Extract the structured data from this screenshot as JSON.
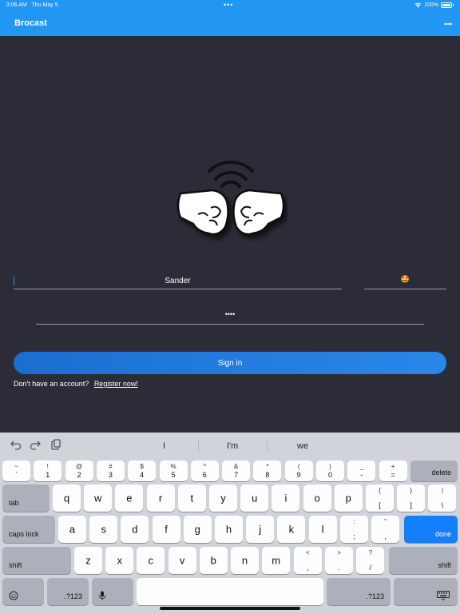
{
  "status": {
    "time": "3:06 AM",
    "date": "Thu May 5",
    "dots": "•••",
    "battery": "100%"
  },
  "app": {
    "title": "Brocast",
    "overflow": "⋮"
  },
  "form": {
    "name_value": "Sander",
    "emoji_value": "🤩",
    "password_value": "••••",
    "signin_label": "Sign in",
    "no_account": "Don't have an account?",
    "register_label": "Register now!"
  },
  "colors": {
    "appbar": "#2196f3",
    "background": "#2b2c37",
    "button": "#1f7de0",
    "keyboard": "#d1d3da",
    "done_key": "#147efb"
  },
  "keyboard": {
    "suggestions": [
      "I",
      "I'm",
      "we"
    ],
    "tool_icons": [
      "undo-icon",
      "redo-icon",
      "clipboard-icon"
    ],
    "row1": [
      {
        "t": "~",
        "b": "`"
      },
      {
        "t": "!",
        "b": "1"
      },
      {
        "t": "@",
        "b": "2"
      },
      {
        "t": "#",
        "b": "3"
      },
      {
        "t": "$",
        "b": "4"
      },
      {
        "t": "%",
        "b": "5"
      },
      {
        "t": "^",
        "b": "6"
      },
      {
        "t": "&",
        "b": "7"
      },
      {
        "t": "*",
        "b": "8"
      },
      {
        "t": "(",
        "b": "9"
      },
      {
        "t": ")",
        "b": "0"
      },
      {
        "t": "_",
        "b": "-"
      },
      {
        "t": "+",
        "b": "="
      }
    ],
    "delete": "delete",
    "tab": "tab",
    "row2": [
      "q",
      "w",
      "e",
      "r",
      "t",
      "y",
      "u",
      "i",
      "o",
      "p"
    ],
    "row2_sym": [
      {
        "t": "{",
        "b": "["
      },
      {
        "t": "}",
        "b": "]"
      },
      {
        "t": "|",
        "b": "\\"
      }
    ],
    "caps": "caps lock",
    "row3": [
      "a",
      "s",
      "d",
      "f",
      "g",
      "h",
      "j",
      "k",
      "l"
    ],
    "row3_sym": [
      {
        "t": ":",
        "b": ";"
      },
      {
        "t": "\"",
        "b": ","
      }
    ],
    "done": "done",
    "shift": "shift",
    "row4": [
      "z",
      "x",
      "c",
      "v",
      "b",
      "n",
      "m"
    ],
    "row4_sym": [
      {
        "t": "<",
        "b": ","
      },
      {
        "t": ">",
        "b": "."
      },
      {
        "t": "?",
        "b": "/"
      }
    ],
    "numbers": ".?123",
    "emoji_icon": "emoji-icon",
    "mic_icon": "microphone-icon",
    "hide_icon": "keyboard-hide-icon"
  }
}
